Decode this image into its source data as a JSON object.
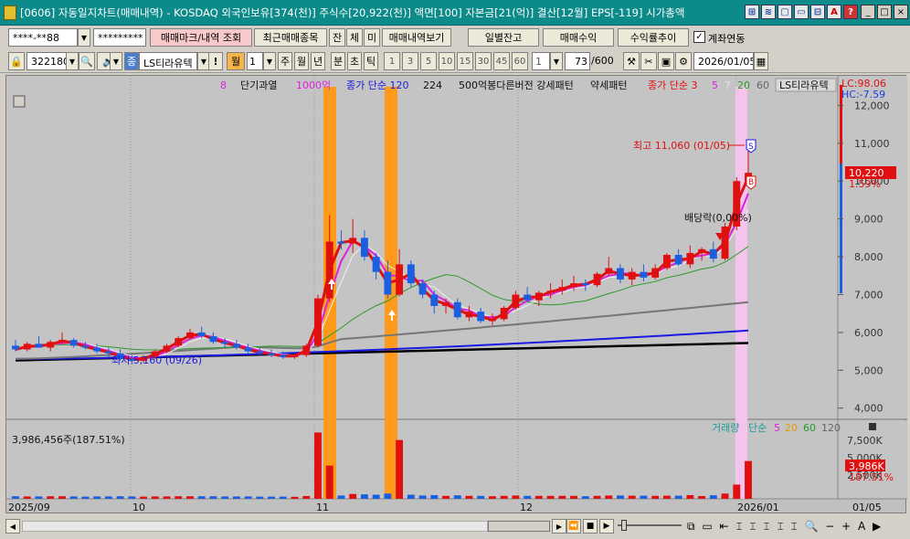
{
  "window": {
    "title": "[0606] 자동일지차트(매매내역) - KOSDAQ 외국인보유[374(천)] 주식수[20,922(천)] 액면[100] 자본금[21(억)] 결산[12월] EPS[-119] 시가총액"
  },
  "title_icons": [
    "⊞",
    "≋",
    "▢",
    "▭",
    "⊟",
    "A",
    "?"
  ],
  "window_controls": [
    "_",
    "□",
    "×"
  ],
  "toolbar1": {
    "account": "****-**88",
    "password": "*********",
    "trade_mark_btn": "매매마크/내역 조회",
    "recent_btn": "최근매매종목",
    "jan": "잔",
    "che": "체",
    "mi": "미",
    "trade_view_btn": "매매내역보기",
    "daily_balance_btn": "일별잔고",
    "trade_profit_btn": "매매수익",
    "return_trend_btn": "수익률추이",
    "account_link_label": "계좌연동"
  },
  "toolbar2": {
    "stock_code": "322180",
    "stock_name": "LS티라유텍",
    "period_options": [
      "월",
      "1",
      "주",
      "월",
      "년",
      "분",
      "초",
      "틱"
    ],
    "minutes": [
      "1",
      "3",
      "5",
      "10",
      "15",
      "30",
      "45",
      "60"
    ],
    "count_value": "1",
    "bars_shown": "73",
    "bars_total": "/600",
    "date": "2026/01/05"
  },
  "legend": {
    "items": [
      {
        "text": "8",
        "color": "#e020e0"
      },
      {
        "text": "단기과열",
        "color": "#111"
      },
      {
        "text": "1000억",
        "color": "#e020e0"
      },
      {
        "text": "종가 단순 120",
        "color": "#1a1ae0"
      },
      {
        "text": "224",
        "color": "#111"
      },
      {
        "text": "500억봉다른버전 강세패턴",
        "color": "#111"
      },
      {
        "text": "약세패턴",
        "color": "#111"
      },
      {
        "text": "종가 단순 3",
        "color": "#e01010"
      },
      {
        "text": "5",
        "color": "#e020e0"
      },
      {
        "text": "7",
        "color": "#e0e0e0"
      },
      {
        "text": "20",
        "color": "#2a9a2a"
      },
      {
        "text": "60",
        "color": "#666"
      }
    ],
    "stock_label": "LS티라유텍"
  },
  "price_axis": {
    "lc": "LC:98.06",
    "hc": "HC:-7.59",
    "ticks": [
      "12,000",
      "11,000",
      "10,000",
      "9,000",
      "8,000",
      "7,000",
      "6,000",
      "5,000",
      "4,000"
    ],
    "current_price": "10,220",
    "current_pct": "1.59%"
  },
  "annotations": {
    "high": "최고 11,060 (01/05)",
    "low": "최저 5,160 (09/26)",
    "dividend": "배당락(0,00%)",
    "buy_mark": "B",
    "sell_mark": "S"
  },
  "volume_panel": {
    "info": "3,986,456주(187.51%)",
    "legend": [
      "거래량",
      "단순",
      "5",
      "20",
      "60",
      "120"
    ],
    "legend_colors": [
      "#1a9a9a",
      "#1a9a9a",
      "#e020e0",
      "#e0a000",
      "#2a9a2a",
      "#666"
    ],
    "axis_ticks": [
      "7,500K",
      "5,000K",
      "2,500K"
    ],
    "current_vol": "3,986K",
    "current_pct": "187.51%"
  },
  "x_axis": {
    "labels": [
      "2025/09",
      "10",
      "11",
      "12",
      "2026/01"
    ],
    "right_label": "01/05"
  },
  "chart_data": {
    "type": "candlestick",
    "y_range": [
      3800,
      12300
    ],
    "candles": [
      [
        5650,
        5800,
        5500,
        5550
      ],
      [
        5550,
        5750,
        5500,
        5700
      ],
      [
        5700,
        5900,
        5650,
        5600
      ],
      [
        5600,
        5800,
        5500,
        5750
      ],
      [
        5750,
        6000,
        5700,
        5800
      ],
      [
        5800,
        5850,
        5600,
        5650
      ],
      [
        5650,
        5750,
        5550,
        5600
      ],
      [
        5600,
        5700,
        5450,
        5500
      ],
      [
        5500,
        5600,
        5350,
        5450
      ],
      [
        5450,
        5550,
        5250,
        5300
      ],
      [
        5300,
        5400,
        5160,
        5250
      ],
      [
        5250,
        5400,
        5200,
        5350
      ],
      [
        5350,
        5550,
        5300,
        5500
      ],
      [
        5500,
        5700,
        5450,
        5650
      ],
      [
        5650,
        5900,
        5600,
        5850
      ],
      [
        5850,
        6100,
        5800,
        6000
      ],
      [
        6000,
        6150,
        5850,
        5900
      ],
      [
        5900,
        6000,
        5700,
        5750
      ],
      [
        5750,
        5850,
        5600,
        5700
      ],
      [
        5700,
        5800,
        5550,
        5600
      ],
      [
        5600,
        5700,
        5450,
        5500
      ],
      [
        5500,
        5600,
        5400,
        5450
      ],
      [
        5450,
        5550,
        5350,
        5400
      ],
      [
        5400,
        5500,
        5300,
        5350
      ],
      [
        5350,
        5450,
        5300,
        5400
      ],
      [
        5400,
        5700,
        5350,
        5650
      ],
      [
        5650,
        7000,
        5600,
        6900
      ],
      [
        6900,
        9100,
        6800,
        8400
      ],
      [
        8400,
        8700,
        8200,
        8350
      ],
      [
        8350,
        9000,
        8100,
        8500
      ],
      [
        8500,
        8700,
        7900,
        8000
      ],
      [
        8000,
        8100,
        7400,
        7600
      ],
      [
        7600,
        7900,
        6900,
        7000
      ],
      [
        7000,
        8200,
        6950,
        7800
      ],
      [
        7800,
        7900,
        7200,
        7300
      ],
      [
        7300,
        7400,
        6900,
        7000
      ],
      [
        7000,
        7100,
        6500,
        6700
      ],
      [
        6700,
        6900,
        6500,
        6800
      ],
      [
        6800,
        6900,
        6350,
        6400
      ],
      [
        6400,
        6700,
        6300,
        6550
      ],
      [
        6550,
        6650,
        6250,
        6300
      ],
      [
        6300,
        6500,
        6200,
        6350
      ],
      [
        6350,
        6700,
        6300,
        6650
      ],
      [
        6650,
        7100,
        6600,
        7000
      ],
      [
        7000,
        7200,
        6800,
        6850
      ],
      [
        6850,
        7100,
        6700,
        7050
      ],
      [
        7050,
        7300,
        6900,
        7100
      ],
      [
        7100,
        7400,
        7000,
        7200
      ],
      [
        7200,
        7500,
        7100,
        7300
      ],
      [
        7300,
        7400,
        7100,
        7250
      ],
      [
        7250,
        7600,
        7200,
        7550
      ],
      [
        7550,
        8000,
        7500,
        7700
      ],
      [
        7700,
        7800,
        7300,
        7400
      ],
      [
        7400,
        7700,
        7250,
        7600
      ],
      [
        7600,
        7800,
        7350,
        7450
      ],
      [
        7450,
        7800,
        7400,
        7700
      ],
      [
        7700,
        8100,
        7650,
        8050
      ],
      [
        8050,
        8200,
        7750,
        7800
      ],
      [
        7800,
        8300,
        7700,
        8100
      ],
      [
        8100,
        8250,
        7900,
        8200
      ],
      [
        8200,
        8400,
        7850,
        7950
      ],
      [
        7950,
        8900,
        7900,
        8800
      ],
      [
        8800,
        10100,
        8700,
        10000
      ],
      [
        10000,
        11060,
        9900,
        10220
      ]
    ]
  }
}
